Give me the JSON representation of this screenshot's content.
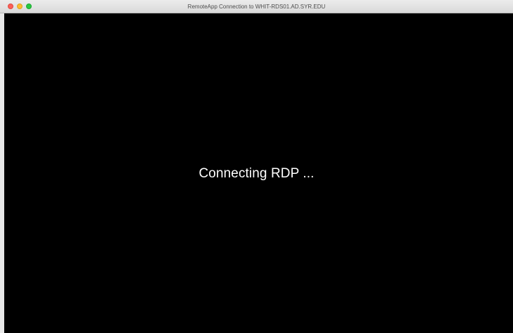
{
  "window": {
    "title": "RemoteApp Connection to WHIT-RDS01.AD.SYR.EDU",
    "controls": {
      "close": "close-icon",
      "minimize": "minimize-icon",
      "zoom": "zoom-icon"
    },
    "colors": {
      "close": "#fc5f57",
      "minimize": "#fdbc2e",
      "zoom": "#28c840",
      "background": "#000000"
    }
  },
  "session": {
    "status": "Connecting RDP ..."
  }
}
